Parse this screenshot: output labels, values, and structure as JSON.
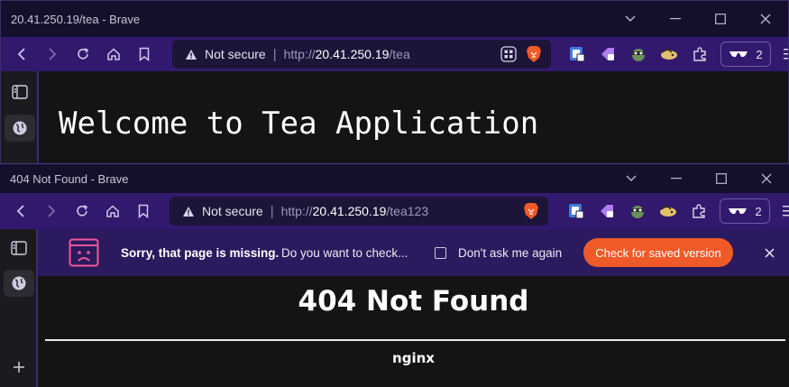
{
  "windows": [
    {
      "title": "20.41.250.19/tea - Brave",
      "address": {
        "security": "Not secure",
        "scheme": "http://",
        "host": "20.41.250.19",
        "path": "/tea"
      },
      "wallet_count": "2",
      "page": {
        "heading": "Welcome to Tea Application"
      }
    },
    {
      "title": "404 Not Found - Brave",
      "address": {
        "security": "Not secure",
        "scheme": "http://",
        "host": "20.41.250.19",
        "path": "/tea123"
      },
      "wallet_count": "2",
      "infobar": {
        "message_strong": "Sorry, that page is missing.",
        "message": "Do you want to check...",
        "checkbox_label": "Don't ask me again",
        "action_label": "Check for saved version"
      },
      "page": {
        "heading": "404 Not Found",
        "server": "nginx"
      }
    }
  ],
  "colors": {
    "titlebar": "#160f2c",
    "toolbar": "#32196e",
    "accent_orange": "#f05a28",
    "page_bg": "#141414"
  },
  "icons": [
    "back-icon",
    "forward-icon",
    "reload-icon",
    "home-icon",
    "bookmark-icon",
    "warning-icon",
    "grid-icon",
    "brave-lion-icon",
    "extension-icon",
    "puzzle-icon",
    "sunglasses-icon",
    "menu-icon",
    "sidebar-toggle-icon",
    "globe-icon",
    "plus-icon",
    "close-icon"
  ]
}
